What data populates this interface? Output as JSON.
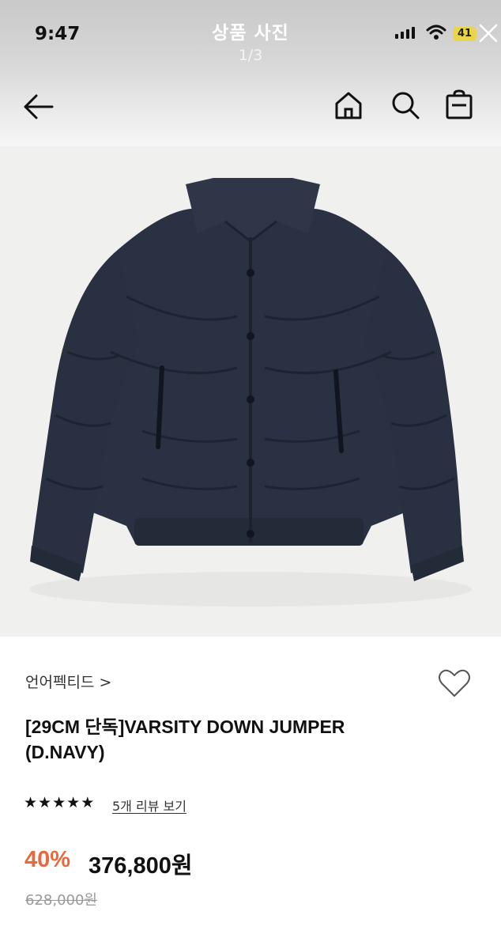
{
  "status_bar": {
    "time": "9:47",
    "battery": "41"
  },
  "viewer": {
    "title": "상품 사진",
    "counter": "1/3"
  },
  "icons": {
    "back": "arrow-left-icon",
    "home": "home-icon",
    "search": "search-icon",
    "cart": "shopping-bag-icon",
    "close": "close-icon",
    "wishlist": "heart-icon"
  },
  "product": {
    "brand": "언어펙티드 >",
    "title_lines": [
      "[29CM 단독]VARSITY DOWN JUMPER",
      "(D.NAVY)"
    ],
    "rating": {
      "stars": 5,
      "star_glyph": "★",
      "review_text": "5개 리뷰 보기"
    },
    "discount": "40%",
    "price": "376,800원",
    "original_price": "628,000원",
    "colors": {
      "discount": "#e8693b",
      "jacket": "#2a3142"
    }
  }
}
